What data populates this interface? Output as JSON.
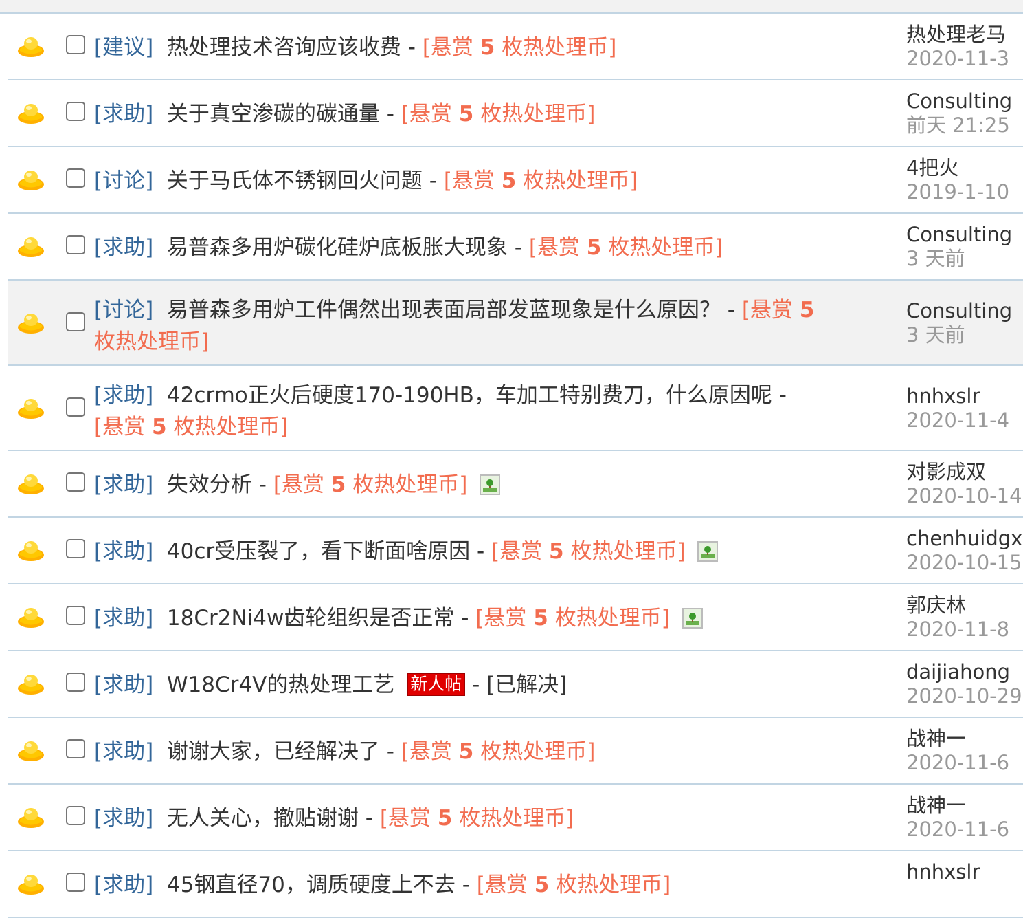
{
  "threads": [
    {
      "category": "[建议]",
      "subject": "热处理技术咨询应该收费",
      "sep": "-",
      "reward": {
        "open": "[悬赏",
        "amount": "5",
        "close": "枚热处理币]"
      },
      "author": "热处理老马",
      "date": "2020-11-3"
    },
    {
      "category": "[求助]",
      "subject": "关于真空渗碳的碳通量",
      "sep": "-",
      "reward": {
        "open": "[悬赏",
        "amount": "5",
        "close": "枚热处理币]"
      },
      "author": "Consulting",
      "date": "前天 21:25"
    },
    {
      "category": "[讨论]",
      "subject": "关于马氏体不锈钢回火问题",
      "sep": "-",
      "reward": {
        "open": "[悬赏",
        "amount": "5",
        "close": "枚热处理币]"
      },
      "author": "4把火",
      "date": "2019-1-10"
    },
    {
      "category": "[求助]",
      "subject": "易普森多用炉碳化硅炉底板胀大现象",
      "sep": "-",
      "reward": {
        "open": "[悬赏",
        "amount": "5",
        "close": "枚热处理币]"
      },
      "author": "Consulting",
      "date": "3 天前"
    },
    {
      "category": "[讨论]",
      "subject": "易普森多用炉工件偶然出现表面局部发蓝现象是什么原因？",
      "sep": "-",
      "reward": {
        "open": "[悬赏",
        "amount": "5",
        "close": "枚热处理币]"
      },
      "author": "Consulting",
      "date": "3 天前"
    },
    {
      "category": "[求助]",
      "subject": "42crmo正火后硬度170-190HB，车加工特别费刀，什么原因呢",
      "sep": "-",
      "reward": {
        "open": "[悬赏",
        "amount": "5",
        "close": "枚热处理币]"
      },
      "author": "hnhxslr",
      "date": "2020-11-4"
    },
    {
      "category": "[求助]",
      "subject": "失效分析",
      "sep": "-",
      "reward": {
        "open": "[悬赏",
        "amount": "5",
        "close": "枚热处理币]"
      },
      "author": "对影成双",
      "date": "2020-10-14"
    },
    {
      "category": "[求助]",
      "subject": "40cr受压裂了，看下断面啥原因",
      "sep": "-",
      "reward": {
        "open": "[悬赏",
        "amount": "5",
        "close": "枚热处理币]"
      },
      "author": "chenhuidgxly",
      "date": "2020-10-15"
    },
    {
      "category": "[求助]",
      "subject": "18Cr2Ni4w齿轮组织是否正常",
      "sep": "-",
      "reward": {
        "open": "[悬赏",
        "amount": "5",
        "close": "枚热处理币]"
      },
      "author": "郭庆林",
      "date": "2020-11-8"
    },
    {
      "category": "[求助]",
      "subject": "W18Cr4V的热处理工艺",
      "badge": "新人帖",
      "sep": "-",
      "status": "[已解决]",
      "author": "daijiahong",
      "date": "2020-10-29"
    },
    {
      "category": "[求助]",
      "subject": "谢谢大家，已经解决了",
      "sep": "-",
      "reward": {
        "open": "[悬赏",
        "amount": "5",
        "close": "枚热处理币]"
      },
      "author": "战神一",
      "date": "2020-11-6"
    },
    {
      "category": "[求助]",
      "subject": "无人关心，撤贴谢谢",
      "sep": "-",
      "reward": {
        "open": "[悬赏",
        "amount": "5",
        "close": "枚热处理币]"
      },
      "author": "战神一",
      "date": "2020-11-6"
    },
    {
      "category": "[求助]",
      "subject": "45钢直径70，调质硬度上不去",
      "sep": "-",
      "reward": {
        "open": "[悬赏",
        "amount": "5",
        "close": "枚热处理币]"
      },
      "author": "hnhxslr",
      "date": ""
    }
  ],
  "icons": {
    "thread_icon": "gold-ingot-icon",
    "attachment": "image-attachment-icon"
  },
  "colors": {
    "category": "#336699",
    "reward": "#f26c4f",
    "date": "#999999",
    "divider": "#c2d5e3",
    "highlight_row": "#f2f2f2",
    "new_badge": "#e00000"
  }
}
